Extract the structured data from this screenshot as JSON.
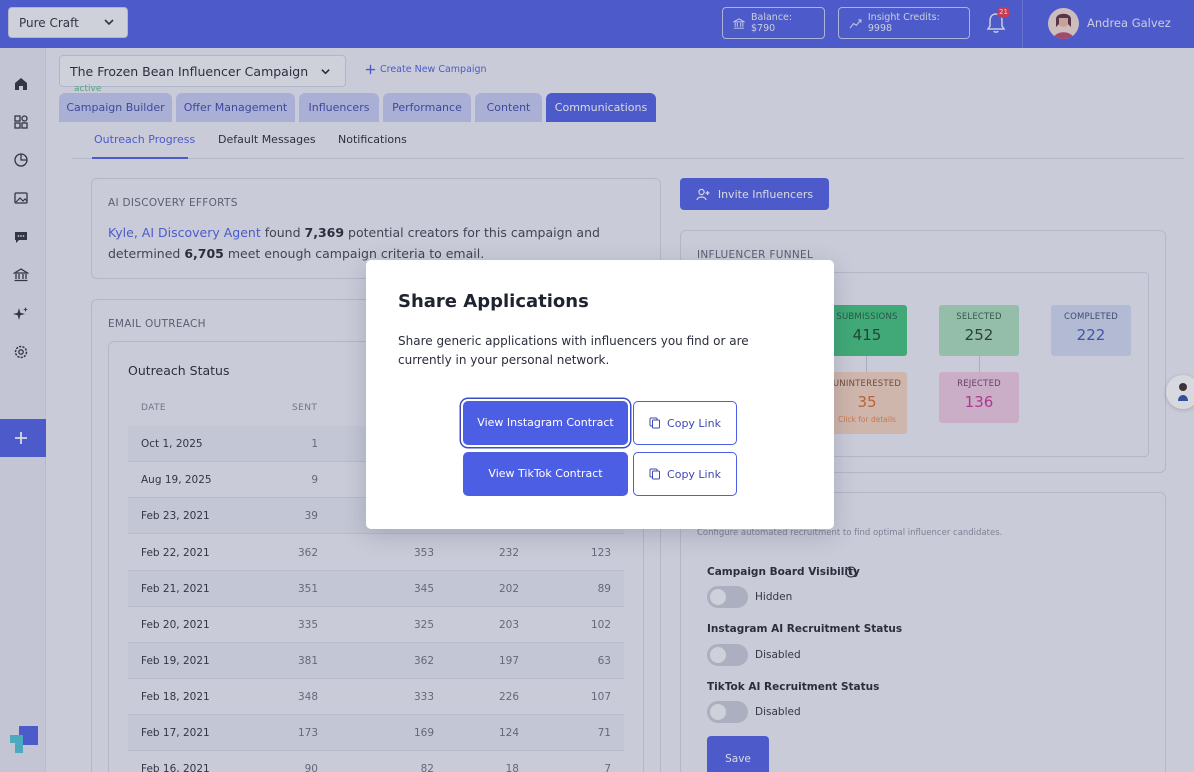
{
  "topbar": {
    "brand_select": "Pure Craft",
    "balance": "Balance: $790",
    "insight_credits": "Insight Credits: 9998",
    "notification_count": "21",
    "user_name": "Andrea Galvez"
  },
  "campaign": {
    "name": "The Frozen Bean Influencer Campaign",
    "status": "active",
    "create_label": "Create New Campaign"
  },
  "tabs": [
    {
      "label": "Campaign Builder"
    },
    {
      "label": "Offer Management"
    },
    {
      "label": "Influencers"
    },
    {
      "label": "Performance"
    },
    {
      "label": "Content"
    },
    {
      "label": "Communications",
      "active": true
    }
  ],
  "subtabs": [
    {
      "label": "Outreach Progress",
      "active": true
    },
    {
      "label": "Default Messages"
    },
    {
      "label": "Notifications"
    }
  ],
  "discovery": {
    "title": "AI DISCOVERY EFFORTS",
    "agent": "Kyle, AI Discovery Agent",
    "text1": " found ",
    "found": "7,369",
    "text2": " potential creators for this campaign and determined ",
    "qualified": "6,705",
    "text3": " meet enough campaign criteria to email."
  },
  "email_outreach": {
    "title": "EMAIL OUTREACH",
    "inner_title": "Outreach Status",
    "columns": [
      "DATE",
      "SENT"
    ],
    "rows": [
      {
        "date": "Oct 1, 2025",
        "sent": "1",
        "c3": "",
        "c4": "",
        "c5": ""
      },
      {
        "date": "Aug 19, 2025",
        "sent": "9",
        "c3": "",
        "c4": "",
        "c5": ""
      },
      {
        "date": "Feb 23, 2021",
        "sent": "39",
        "c3": "",
        "c4": "",
        "c5": ""
      },
      {
        "date": "Feb 22, 2021",
        "sent": "362",
        "c3": "353",
        "c4": "232",
        "c5": "123"
      },
      {
        "date": "Feb 21, 2021",
        "sent": "351",
        "c3": "345",
        "c4": "202",
        "c5": "89"
      },
      {
        "date": "Feb 20, 2021",
        "sent": "335",
        "c3": "325",
        "c4": "203",
        "c5": "102"
      },
      {
        "date": "Feb 19, 2021",
        "sent": "381",
        "c3": "362",
        "c4": "197",
        "c5": "63"
      },
      {
        "date": "Feb 18, 2021",
        "sent": "348",
        "c3": "333",
        "c4": "226",
        "c5": "107"
      },
      {
        "date": "Feb 17, 2021",
        "sent": "173",
        "c3": "169",
        "c4": "124",
        "c5": "71"
      },
      {
        "date": "Feb 16, 2021",
        "sent": "90",
        "c3": "82",
        "c4": "18",
        "c5": "7"
      }
    ]
  },
  "invite_label": "Invite Influencers",
  "funnel": {
    "title": "INFLUENCER FUNNEL",
    "submissions": {
      "label": "SUBMISSIONS",
      "value": "415"
    },
    "selected": {
      "label": "SELECTED",
      "value": "252"
    },
    "completed": {
      "label": "COMPLETED",
      "value": "222"
    },
    "uninterested": {
      "label": "UNINTERESTED",
      "value": "35",
      "hint": "Click for details"
    },
    "rejected": {
      "label": "REJECTED",
      "value": "136"
    }
  },
  "recruitment": {
    "description": "Configure automated recruitment to find optimal influencer candidates.",
    "board_label": "Campaign Board Visibility",
    "board_value": "Hidden",
    "instagram_label": "Instagram AI Recruitment Status",
    "instagram_value": "Disabled",
    "tiktok_label": "TikTok AI Recruitment Status",
    "tiktok_value": "Disabled",
    "save_label": "Save"
  },
  "modal": {
    "title": "Share Applications",
    "description": "Share generic applications with influencers you find or are currently in your personal network.",
    "instagram_button": "View Instagram Contract",
    "tiktok_button": "View TikTok Contract",
    "copy_label": "Copy Link"
  },
  "colors": {
    "primary": "#4c5ee3",
    "submissions_bg": "#3ec27a",
    "selected_bg": "#a8dcbc",
    "completed_bg": "#cfd9f0",
    "uninterested_bg": "#f3d3be",
    "rejected_bg": "#edc8e2"
  }
}
